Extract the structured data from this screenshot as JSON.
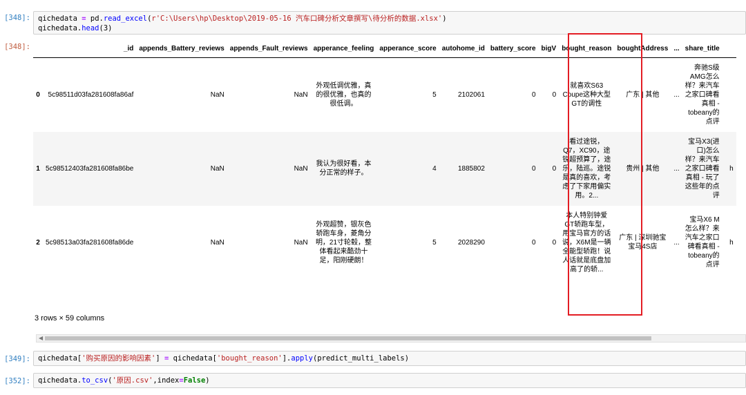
{
  "cells": [
    {
      "prompt": "[348]:",
      "code_parts": [
        {
          "t": "qichedata ",
          "c": ""
        },
        {
          "t": "=",
          "c": "op"
        },
        {
          "t": " pd.",
          "c": ""
        },
        {
          "t": "read_excel",
          "c": "fn"
        },
        {
          "t": "(",
          "c": ""
        },
        {
          "t": "r'C:\\Users\\hp\\Desktop\\2019-05-16 汽车口碑分析文章撰写\\待分析的数据.xlsx'",
          "c": "str"
        },
        {
          "t": ")\nqichedata.",
          "c": ""
        },
        {
          "t": "head",
          "c": "fn"
        },
        {
          "t": "(3)",
          "c": ""
        }
      ]
    },
    {
      "prompt": "[349]:",
      "code_parts": [
        {
          "t": "qichedata[",
          "c": ""
        },
        {
          "t": "'购买原因的影响因素'",
          "c": "str"
        },
        {
          "t": "] ",
          "c": ""
        },
        {
          "t": "=",
          "c": "op"
        },
        {
          "t": " qichedata[",
          "c": ""
        },
        {
          "t": "'bought_reason'",
          "c": "str"
        },
        {
          "t": "].",
          "c": ""
        },
        {
          "t": "apply",
          "c": "fn"
        },
        {
          "t": "(predict_multi_labels)",
          "c": ""
        }
      ]
    },
    {
      "prompt": "[352]:",
      "code_parts": [
        {
          "t": "qichedata.",
          "c": ""
        },
        {
          "t": "to_csv",
          "c": "fn"
        },
        {
          "t": "(",
          "c": ""
        },
        {
          "t": "'原因.csv'",
          "c": "str"
        },
        {
          "t": ",index",
          "c": ""
        },
        {
          "t": "=",
          "c": "op"
        },
        {
          "t": "False",
          "c": "kw"
        },
        {
          "t": ")",
          "c": ""
        }
      ]
    }
  ],
  "output_prompt": "[348]:",
  "dataframe": {
    "columns": [
      "",
      "_id",
      "appends_Battery_reviews",
      "appends_Fault_reviews",
      "apperance_feeling",
      "apperance_score",
      "autohome_id",
      "battery_score",
      "bigV",
      "bought_reason",
      "boughtAddress",
      "...",
      "share_title",
      ""
    ],
    "rows": [
      {
        "index": "0",
        "_id": "5c98511d03fa281608fa86af",
        "appends_Battery_reviews": "NaN",
        "appends_Fault_reviews": "NaN",
        "apperance_feeling": "外观低调优雅，真的很优雅，也真的很低调。",
        "apperance_score": "5",
        "autohome_id": "2102061",
        "battery_score": "0",
        "bigV": "0",
        "bought_reason": "就喜欢S63 Coupe这种大型GT的调性",
        "boughtAddress": "广东 | 其他",
        "dots": "...",
        "share_title": "奔驰S级 AMG怎么样？来汽车之家口碑看真相 - tobeany的点评",
        "extra": ""
      },
      {
        "index": "1",
        "_id": "5c98512403fa281608fa86be",
        "appends_Battery_reviews": "NaN",
        "appends_Fault_reviews": "NaN",
        "apperance_feeling": "我认为很好看，本分正常的样子。",
        "apperance_score": "4",
        "autohome_id": "1885802",
        "battery_score": "0",
        "bigV": "0",
        "bought_reason": "看过途锐，Q7，XC90，途锐超预算了，途乐，陆巡。途锐是真的喜欢，考虑了下家用偏实用。2...",
        "boughtAddress": "贵州 | 其他",
        "dots": "...",
        "share_title": "宝马X3(进口)怎么样？来汽车之家口碑看真相 - 玩了这些年的点评",
        "extra": "h"
      },
      {
        "index": "2",
        "_id": "5c98513a03fa281608fa86de",
        "appends_Battery_reviews": "NaN",
        "appends_Fault_reviews": "NaN",
        "apperance_feeling": "外观超赞，银灰色轿跑车身，菱角分明，21寸轮毂，整体看起来酷劲十足，阳刚硬朗！",
        "apperance_score": "5",
        "autohome_id": "2028290",
        "battery_score": "0",
        "bigV": "0",
        "bought_reason": "本人特别钟爱GT轿跑车型，用宝马官方的话说，X6M是一辆全能型轿跑！说人话就是底盘加高了的轿...",
        "boughtAddress": "广东 | 深圳驰宝宝马4S店",
        "dots": "...",
        "share_title": "宝马X6 M怎么样？来汽车之家口碑看真相 - tobeany的点评",
        "extra": "h"
      }
    ],
    "shape_text": "3 rows × 59 columns"
  },
  "colors": {
    "highlight": "#e31c23",
    "in_prompt": "#307fc1",
    "out_prompt": "#bf5b3d",
    "string": "#ba2121",
    "function": "#0000ff"
  },
  "icons": {
    "scroll_left": "triangle-left-icon"
  }
}
